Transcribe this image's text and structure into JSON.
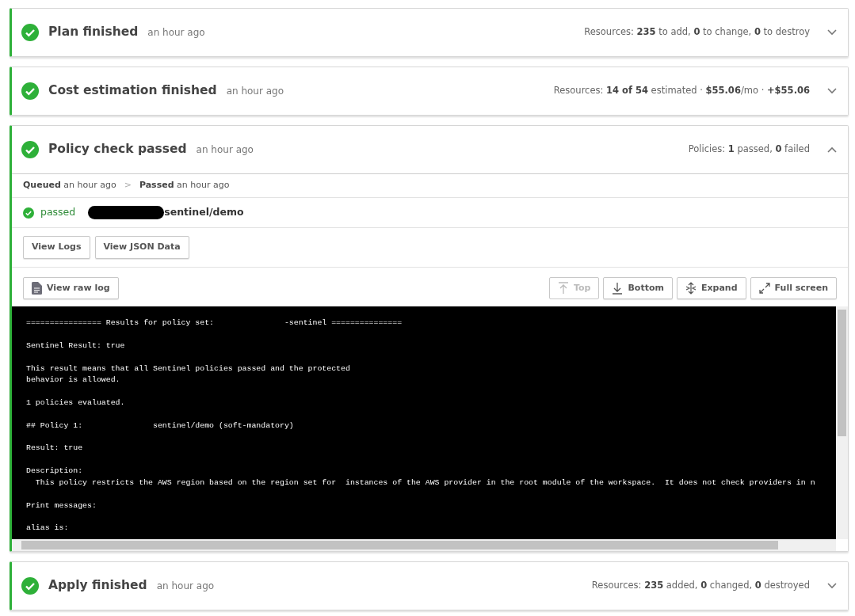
{
  "sections": [
    {
      "title": "Plan finished",
      "time": "an hour ago",
      "summary": "Resources: **235** to add, **0** to change, **0** to destroy",
      "expanded": false
    },
    {
      "title": "Cost estimation finished",
      "time": "an hour ago",
      "summary": "Resources: **14 of 54** estimated · **$55.06**/mo · **+$55.06**",
      "expanded": false
    },
    {
      "title": "Policy check passed",
      "time": "an hour ago",
      "summary": "Policies: **1** passed, **0** failed",
      "expanded": true,
      "details": {
        "timeline": [
          {
            "label": "Queued",
            "time": "an hour ago"
          },
          {
            "label": "Passed",
            "time": "an hour ago"
          }
        ],
        "separator": ">",
        "result": {
          "status": "passed",
          "policy": "sentinel/demo"
        },
        "buttons": [
          {
            "label": "View Logs"
          },
          {
            "label": "View JSON Data"
          }
        ],
        "raw_log_button": "View raw log",
        "log_tools": [
          {
            "kind": "top",
            "label": "Top",
            "disabled": true
          },
          {
            "kind": "bottom",
            "label": "Bottom",
            "disabled": false
          },
          {
            "kind": "expand",
            "label": "Expand",
            "disabled": false
          },
          {
            "kind": "fullscreen",
            "label": "Full screen",
            "disabled": false
          }
        ],
        "log_blocks": [
          [
            "================ Results for policy set:               -sentinel ==============="
          ],
          [
            "Sentinel Result: true"
          ],
          [
            "This result means that all Sentinel policies passed and the protected",
            "behavior is allowed."
          ],
          [
            "1 policies evaluated."
          ],
          [
            "## Policy 1:               sentinel/demo (soft-mandatory)"
          ],
          [
            "Result: true"
          ],
          [
            "Description:",
            "  This policy restricts the AWS region based on the region set for  instances of the AWS provider in the root module of the workspace.  It does not check providers in n"
          ],
          [
            "Print messages:"
          ],
          [
            "alias is:"
          ]
        ]
      }
    },
    {
      "title": "Apply finished",
      "time": "an hour ago",
      "summary": "Resources: **235** added, **0** changed, **0** destroyed",
      "expanded": false
    }
  ]
}
